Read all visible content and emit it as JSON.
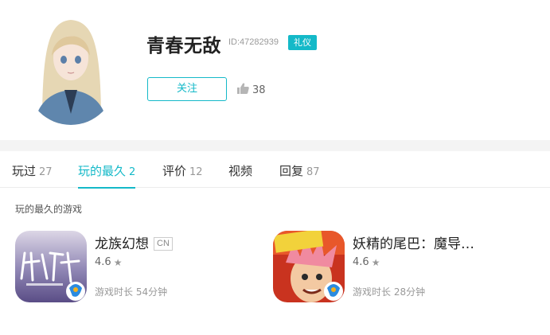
{
  "profile": {
    "username": "青春无敌",
    "user_id": "ID:47282939",
    "badge": "礼仪",
    "follow_label": "关注",
    "likes": "38"
  },
  "tabs": [
    {
      "label": "玩过",
      "count": "27"
    },
    {
      "label": "玩的最久",
      "count": "2"
    },
    {
      "label": "评价",
      "count": "12"
    },
    {
      "label": "视频",
      "count": ""
    },
    {
      "label": "回复",
      "count": "87"
    }
  ],
  "section_title": "玩的最久的游戏",
  "games": [
    {
      "title": "龙族幻想",
      "tag": "CN",
      "rating": "4.6",
      "playtime": "游戏时长 54分钟",
      "icon": "longzu-game-icon"
    },
    {
      "title": "妖精的尾巴：魔导…",
      "tag": "",
      "rating": "4.6",
      "playtime": "游戏时长 28分钟",
      "icon": "fairy-tail-game-icon"
    }
  ],
  "colors": {
    "accent": "#14b9c8"
  }
}
